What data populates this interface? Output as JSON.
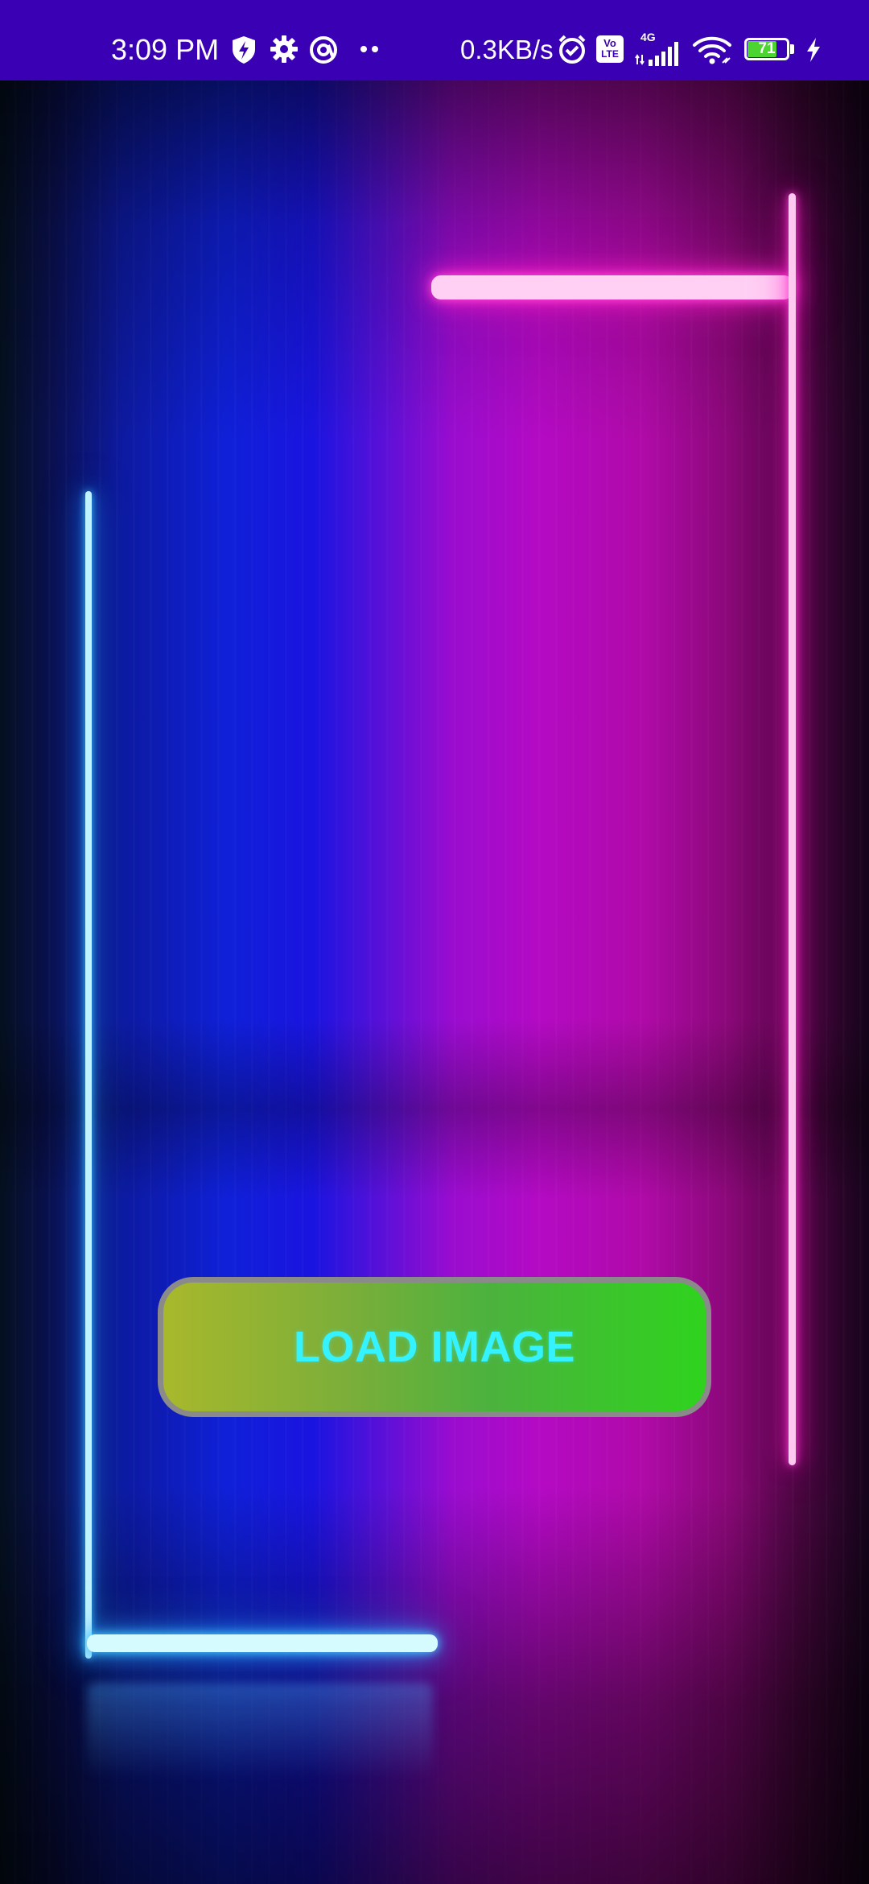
{
  "status_bar": {
    "time": "3:09 PM",
    "network_speed": "0.3KB/s",
    "network_type": "4G",
    "volte_label_top": "Vo",
    "volte_label_bottom": "LTE",
    "battery_level": "71",
    "icons": [
      "shield-bolt-icon",
      "gear-icon",
      "at-sign-icon",
      "more-dots-icon",
      "alarm-icon",
      "volte-icon",
      "signal-icon",
      "wifi-icon",
      "battery-icon",
      "charging-bolt-icon"
    ],
    "background_color": "#3a00b4"
  },
  "main": {
    "load_button_label": "LOAD IMAGE",
    "load_button_text_color": "#35f2ff",
    "load_button_gradient": [
      "#a8b82c",
      "#2fd31e"
    ]
  }
}
